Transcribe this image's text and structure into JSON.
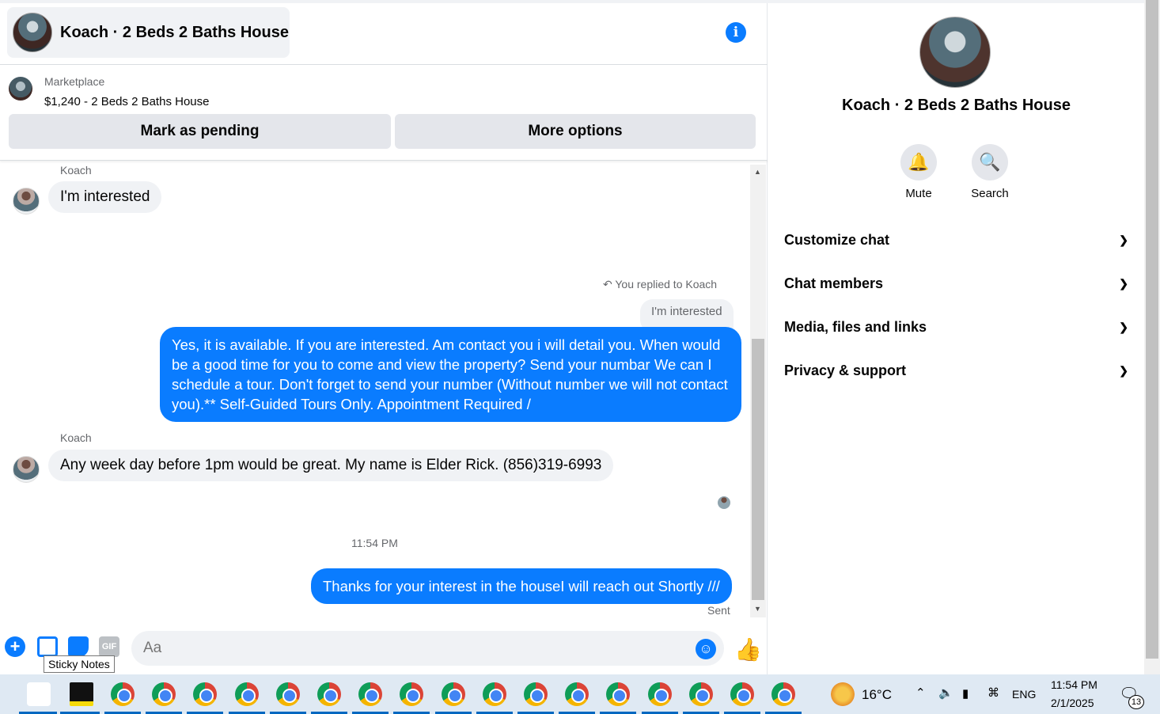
{
  "header": {
    "title": "Koach · 2 Beds 2 Baths House",
    "info_icon": "i"
  },
  "listing": {
    "source": "Marketplace",
    "title": "$1,240 - 2 Beds 2 Baths House",
    "mark_pending_label": "Mark as pending",
    "more_options_label": "More options"
  },
  "messages": {
    "sender_1": "Koach",
    "msg_1": "I'm interested",
    "reply_note": "You replied to Koach",
    "reply_quote": "I'm interested",
    "msg_2": "Yes, it is available. If you are interested.  Am contact you i will detail you.  When would be a good time for you to come and view the property? Send your numbar We can I schedule a tour.  Don't forget to send your number (Without number we will not contact you).** Self-Guided Tours Only. Appointment Required /",
    "sender_2": "Koach",
    "msg_3": "Any week day before 1pm would be great. My name is Elder Rick. (856)319-6993",
    "timestamp": "11:54 PM",
    "msg_4": "Thanks for your interest in the houseI will reach out Shortly ///",
    "status": "Sent"
  },
  "composer": {
    "placeholder": "Aa",
    "gif_label": "GIF",
    "tooltip": "Sticky Notes"
  },
  "side": {
    "title": "Koach · 2 Beds 2 Baths House",
    "mute_label": "Mute",
    "search_label": "Search",
    "menu": [
      "Customize chat",
      "Chat members",
      "Media, files and links",
      "Privacy & support"
    ]
  },
  "taskbar": {
    "weather": "16°C",
    "language": "ENG",
    "time": "11:54 PM",
    "date": "2/1/2025",
    "notifications": "13"
  },
  "colors": {
    "accent": "#0a7cff",
    "bubble_in": "#f0f2f5",
    "taskbar": "#dfe9f3"
  }
}
